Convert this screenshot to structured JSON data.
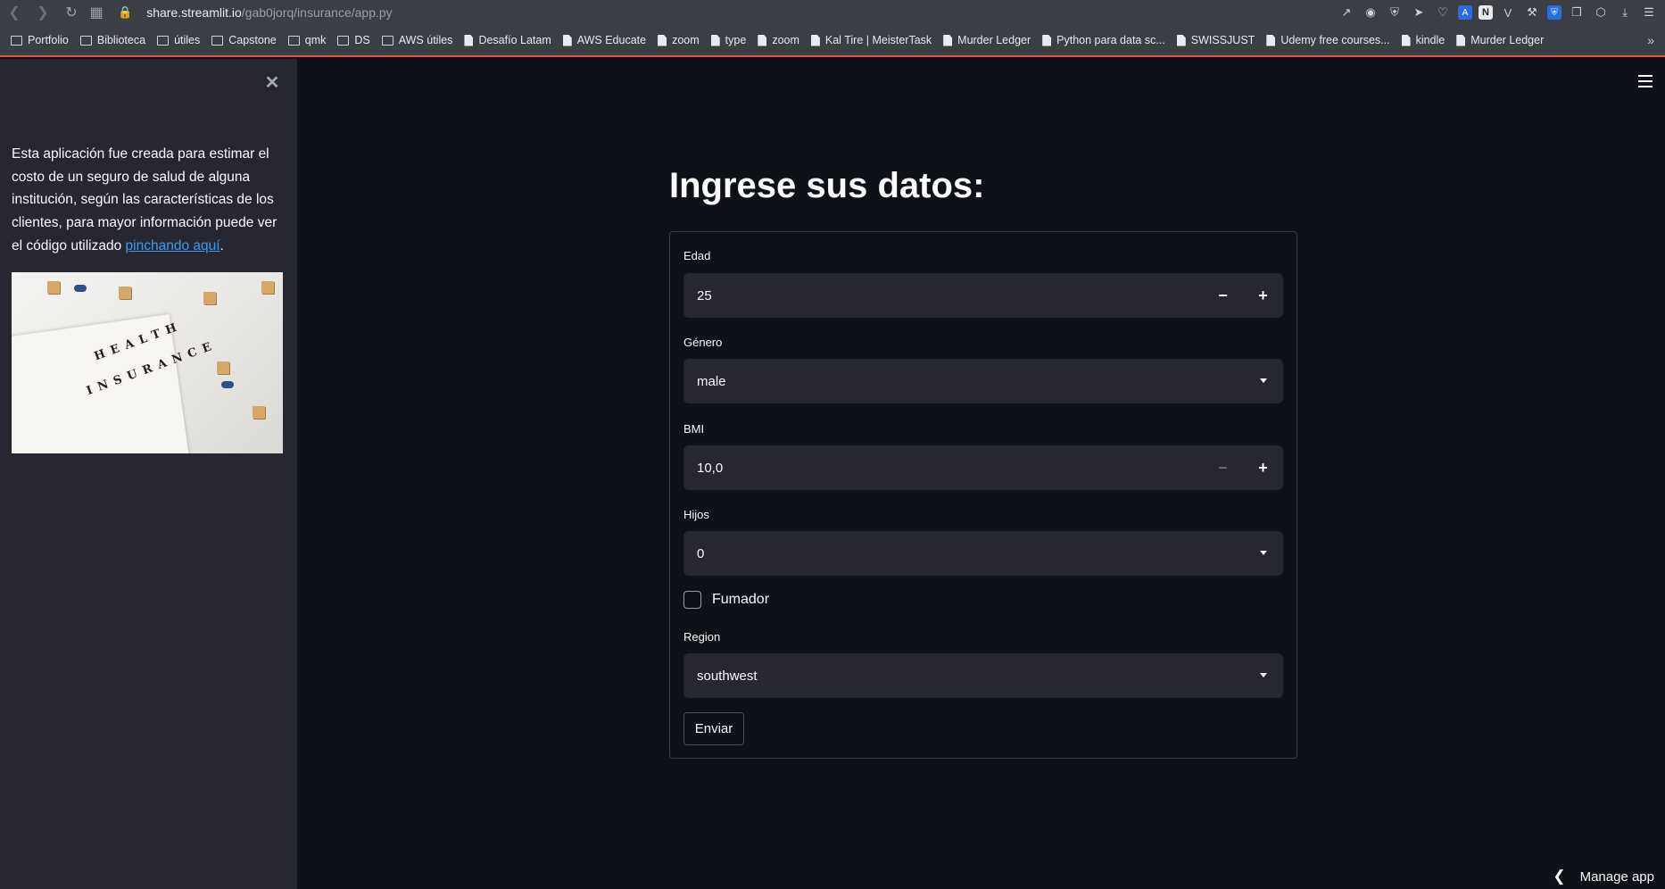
{
  "browser": {
    "url_host": "share.streamlit.io",
    "url_path": "/gab0jorq/insurance/app.py",
    "bookmarks": [
      {
        "label": "Portfolio",
        "type": "folder"
      },
      {
        "label": "Biblioteca",
        "type": "folder"
      },
      {
        "label": "útiles",
        "type": "folder"
      },
      {
        "label": "Capstone",
        "type": "folder"
      },
      {
        "label": "qmk",
        "type": "folder"
      },
      {
        "label": "DS",
        "type": "folder"
      },
      {
        "label": "AWS útiles",
        "type": "folder"
      },
      {
        "label": "Desafío Latam",
        "type": "file"
      },
      {
        "label": "AWS Educate",
        "type": "file"
      },
      {
        "label": "zoom",
        "type": "file"
      },
      {
        "label": "type",
        "type": "file"
      },
      {
        "label": "zoom",
        "type": "file"
      },
      {
        "label": "Kal Tire | MeisterTask",
        "type": "file"
      },
      {
        "label": "Murder Ledger",
        "type": "file"
      },
      {
        "label": "Python para data sc...",
        "type": "file"
      },
      {
        "label": "SWISSJUST",
        "type": "file"
      },
      {
        "label": "Udemy free courses...",
        "type": "file"
      },
      {
        "label": "kindle",
        "type": "file"
      },
      {
        "label": "Murder Ledger",
        "type": "file"
      }
    ]
  },
  "sidebar": {
    "text_before_link": "Esta aplicación fue creada para estimar el costo de un seguro de salud de alguna institución, según las características de los clientes, para mayor información puede ver el código utilizado ",
    "link_text": "pinchando aquí",
    "text_after_link": ".",
    "image_words": [
      "HEALTH",
      "INSURANCE"
    ]
  },
  "main": {
    "title": "Ingrese sus datos:",
    "fields": {
      "age": {
        "label": "Edad",
        "value": "25"
      },
      "gender": {
        "label": "Género",
        "value": "male"
      },
      "bmi": {
        "label": "BMI",
        "value": "10,0"
      },
      "children": {
        "label": "Hijos",
        "value": "0"
      },
      "smoker": {
        "label": "Fumador",
        "checked": false
      },
      "region": {
        "label": "Region",
        "value": "southwest"
      }
    },
    "submit_label": "Enviar"
  },
  "footer": {
    "manage_label": "Manage app"
  },
  "colors": {
    "accent_link": "#3c9bf0",
    "background": "#0e1117",
    "sidebar": "#262730",
    "input": "#262730"
  }
}
